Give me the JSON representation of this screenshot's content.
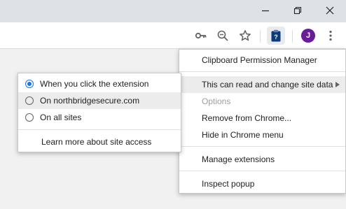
{
  "window_controls": {
    "minimize_icon": "minimize-icon",
    "restore_icon": "restore-icon",
    "close_icon": "close-icon"
  },
  "toolbar": {
    "icons": [
      "key-icon",
      "zoom-out-icon",
      "star-icon",
      "clipboard-extension-icon",
      "menu-kebab-icon"
    ],
    "avatar_letter": "J",
    "avatar_color": "#6a1b9a"
  },
  "extension_menu": {
    "items": [
      {
        "label": "Clipboard Permission Manager"
      },
      {
        "label": "This can read and change site data"
      },
      {
        "label": "Options"
      },
      {
        "label": "Remove from Chrome..."
      },
      {
        "label": "Hide in Chrome menu"
      },
      {
        "label": "Manage extensions"
      },
      {
        "label": "Inspect popup"
      }
    ]
  },
  "site_access_menu": {
    "options": [
      {
        "label": "When you click the extension",
        "selected": true
      },
      {
        "label": "On northbridgesecure.com",
        "selected": false
      },
      {
        "label": "On all sites",
        "selected": false
      }
    ],
    "learn_more": "Learn more about site access"
  },
  "colors": {
    "accent": "#1a73e8",
    "highlight": "#ececec",
    "disabled_text": "#9e9e9e"
  }
}
